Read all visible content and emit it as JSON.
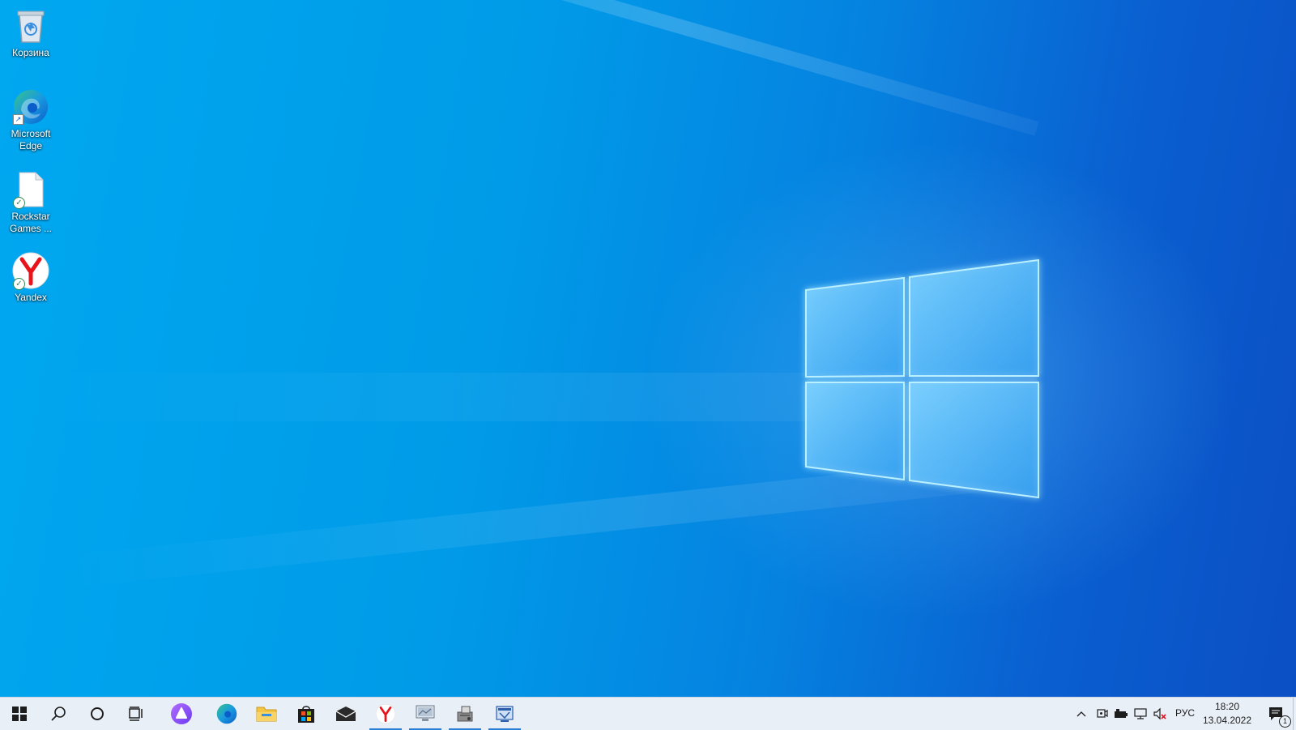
{
  "desktop": {
    "icons": [
      {
        "label": "Корзина",
        "icon": "recycle-bin-icon"
      },
      {
        "label": "Microsoft Edge",
        "icon": "edge-icon"
      },
      {
        "label": "Rockstar Games ...",
        "icon": "document-icon"
      },
      {
        "label": "Yandex",
        "icon": "yandex-browser-icon"
      }
    ],
    "sync_mark": "✓",
    "shortcut_mark": "↗"
  },
  "taskbar": {
    "pinned": [
      {
        "name": "start-button",
        "icon": "windows-logo-icon",
        "active": false
      },
      {
        "name": "search-button",
        "icon": "search-icon",
        "active": false
      },
      {
        "name": "cortana-button",
        "icon": "circle-icon",
        "active": false
      },
      {
        "name": "task-view-button",
        "icon": "task-view-icon",
        "active": false
      },
      {
        "name": "alice-button",
        "icon": "alice-assistant-icon",
        "active": false
      },
      {
        "name": "edge-taskbar-button",
        "icon": "edge-icon",
        "active": false
      },
      {
        "name": "file-explorer-button",
        "icon": "folder-icon",
        "active": false
      },
      {
        "name": "store-button",
        "icon": "store-icon",
        "active": false
      },
      {
        "name": "mail-button",
        "icon": "mail-icon",
        "active": false
      },
      {
        "name": "yandex-taskbar-button",
        "icon": "yandex-browser-icon",
        "active": true
      },
      {
        "name": "app-window-1-button",
        "icon": "monitor-icon",
        "active": true
      },
      {
        "name": "app-window-2-button",
        "icon": "installer-icon",
        "active": true
      },
      {
        "name": "app-window-3-button",
        "icon": "setup-icon",
        "active": true
      }
    ],
    "tray": {
      "icons": [
        "chevron-up-icon",
        "meet-now-icon",
        "battery-icon",
        "network-icon",
        "volume-muted-icon"
      ],
      "language": "РУС",
      "time": "18:20",
      "date": "13.04.2022",
      "notifications_count": "1"
    }
  },
  "colors": {
    "accent": "#2a7fd4",
    "taskbar_bg": "#e9eff6",
    "wallpaper_light": "#00a8f0",
    "wallpaper_dark": "#0b4fc4"
  }
}
